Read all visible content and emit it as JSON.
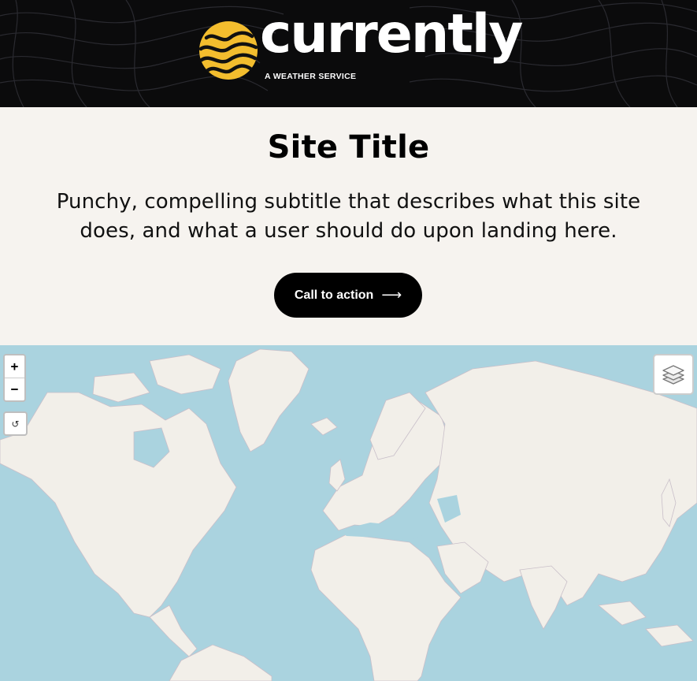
{
  "header": {
    "brand_name": "currently",
    "brand_tagline": "A WEATHER SERVICE",
    "logo_icon": "sun-waves-icon",
    "colors": {
      "background": "#0b0b0c",
      "logo_yellow": "#f3bd2e",
      "text": "#ffffff"
    }
  },
  "hero": {
    "title": "Site Title",
    "subtitle": "Punchy, compelling subtitle that describes what this site does, and what a user should do upon landing here.",
    "cta_label": "Call to action",
    "cta_icon": "arrow-right-icon",
    "colors": {
      "background": "#f6f3ef",
      "button": "#000000"
    }
  },
  "map": {
    "zoom_in_label": "+",
    "zoom_out_label": "−",
    "reset_label": "↺",
    "layers_icon": "layers-icon",
    "colors": {
      "water": "#aad3df",
      "land": "#f2efe9",
      "borders": "#b5a9b8"
    }
  }
}
